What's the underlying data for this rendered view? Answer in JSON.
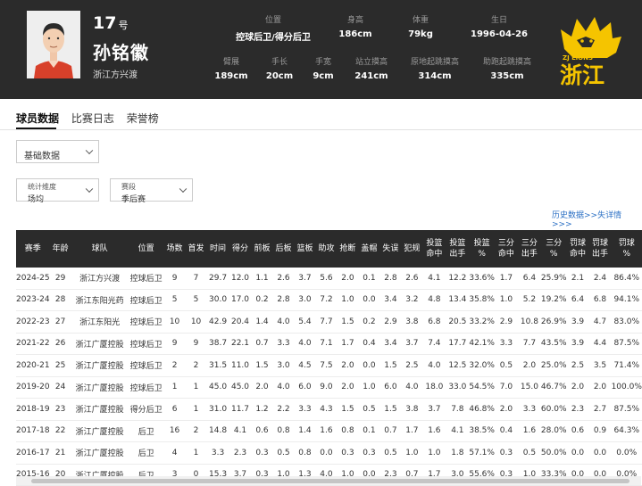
{
  "player": {
    "number": "17",
    "number_suffix": "号",
    "name": "孙铭徽",
    "team": "浙江方兴渡"
  },
  "info_top": [
    {
      "label": "位置",
      "value": "控球后卫/得分后卫"
    },
    {
      "label": "身高",
      "value": "186cm"
    },
    {
      "label": "体重",
      "value": "79kg"
    },
    {
      "label": "生日",
      "value": "1996-04-26"
    }
  ],
  "info_bottom": [
    {
      "label": "臂展",
      "value": "189cm"
    },
    {
      "label": "手长",
      "value": "20cm"
    },
    {
      "label": "手宽",
      "value": "9cm"
    },
    {
      "label": "站立摸高",
      "value": "241cm"
    },
    {
      "label": "原地起跳摸高",
      "value": "314cm"
    },
    {
      "label": "助跑起跳摸高",
      "value": "335cm"
    }
  ],
  "logo": {
    "text_small": "ZJ LIONS",
    "text_big": "浙江",
    "color": "#f5c400"
  },
  "tabs": [
    "球员数据",
    "比赛日志",
    "荣誉榜"
  ],
  "filters": {
    "type": "基础数据",
    "dimension_label": "统计维度",
    "dimension_value": "场均",
    "season_label": "赛段",
    "season_value": "季后赛"
  },
  "history_link": "历史数据>>失详情 >>>",
  "table": {
    "headers": [
      "赛季",
      "年龄",
      "球队",
      "位置",
      "场数",
      "首发",
      "时间",
      "得分",
      "前板",
      "后板",
      "篮板",
      "助攻",
      "抢断",
      "盖帽",
      "失误",
      "犯规",
      "投篮\n命中",
      "投篮\n出手",
      "投篮\n%",
      "三分\n命中",
      "三分\n出手",
      "三分\n%",
      "罚球\n命中",
      "罚球\n%"
    ],
    "rows": [
      [
        "2024-25",
        "29",
        "浙江方兴渡",
        "控球后卫",
        "9",
        "7",
        "29.7",
        "12.0",
        "1.1",
        "2.6",
        "3.7",
        "5.6",
        "2.0",
        "0.1",
        "2.8",
        "2.6",
        "4.1",
        "12.2",
        "33.6%",
        "1.7",
        "6.4",
        "25.9%",
        "2.1",
        "2.4",
        "86.4%"
      ],
      [
        "2023-24",
        "28",
        "浙江东阳光药",
        "控球后卫",
        "5",
        "5",
        "30.0",
        "17.0",
        "0.2",
        "2.8",
        "3.0",
        "7.2",
        "1.0",
        "0.0",
        "3.4",
        "3.2",
        "4.8",
        "13.4",
        "35.8%",
        "1.0",
        "5.2",
        "19.2%",
        "6.4",
        "6.8",
        "94.1%"
      ],
      [
        "2022-23",
        "27",
        "浙江东阳光",
        "控球后卫",
        "10",
        "10",
        "42.9",
        "20.4",
        "1.4",
        "4.0",
        "5.4",
        "7.7",
        "1.5",
        "0.2",
        "2.9",
        "3.8",
        "6.8",
        "20.5",
        "33.2%",
        "2.9",
        "10.8",
        "26.9%",
        "3.9",
        "4.7",
        "83.0%"
      ],
      [
        "2021-22",
        "26",
        "浙江广厦控股",
        "控球后卫",
        "9",
        "9",
        "38.7",
        "22.1",
        "0.7",
        "3.3",
        "4.0",
        "7.1",
        "1.7",
        "0.4",
        "3.4",
        "3.7",
        "7.4",
        "17.7",
        "42.1%",
        "3.3",
        "7.7",
        "43.5%",
        "3.9",
        "4.4",
        "87.5%"
      ],
      [
        "2020-21",
        "25",
        "浙江广厦控股",
        "控球后卫",
        "2",
        "2",
        "31.5",
        "11.0",
        "1.5",
        "3.0",
        "4.5",
        "7.5",
        "2.0",
        "0.0",
        "1.5",
        "2.5",
        "4.0",
        "12.5",
        "32.0%",
        "0.5",
        "2.0",
        "25.0%",
        "2.5",
        "3.5",
        "71.4%"
      ],
      [
        "2019-20",
        "24",
        "浙江广厦控股",
        "控球后卫",
        "1",
        "1",
        "45.0",
        "45.0",
        "2.0",
        "4.0",
        "6.0",
        "9.0",
        "2.0",
        "1.0",
        "6.0",
        "4.0",
        "18.0",
        "33.0",
        "54.5%",
        "7.0",
        "15.0",
        "46.7%",
        "2.0",
        "2.0",
        "100.0%"
      ],
      [
        "2018-19",
        "23",
        "浙江广厦控股",
        "得分后卫",
        "6",
        "1",
        "31.0",
        "11.7",
        "1.2",
        "2.2",
        "3.3",
        "4.3",
        "1.5",
        "0.5",
        "1.5",
        "3.8",
        "3.7",
        "7.8",
        "46.8%",
        "2.0",
        "3.3",
        "60.0%",
        "2.3",
        "2.7",
        "87.5%"
      ],
      [
        "2017-18",
        "22",
        "浙江广厦控股",
        "后卫",
        "16",
        "2",
        "14.8",
        "4.1",
        "0.6",
        "0.8",
        "1.4",
        "1.6",
        "0.8",
        "0.1",
        "0.7",
        "1.7",
        "1.6",
        "4.1",
        "38.5%",
        "0.4",
        "1.6",
        "28.0%",
        "0.6",
        "0.9",
        "64.3%"
      ],
      [
        "2016-17",
        "21",
        "浙江广厦控股",
        "后卫",
        "4",
        "1",
        "3.3",
        "2.3",
        "0.3",
        "0.5",
        "0.8",
        "0.0",
        "0.3",
        "0.3",
        "0.5",
        "1.0",
        "1.0",
        "1.8",
        "57.1%",
        "0.3",
        "0.5",
        "50.0%",
        "0.0",
        "0.0",
        "0.0%"
      ],
      [
        "2015-16",
        "20",
        "浙江广厦控股",
        "后卫",
        "3",
        "0",
        "15.3",
        "3.7",
        "0.3",
        "1.0",
        "1.3",
        "4.0",
        "1.0",
        "0.0",
        "2.3",
        "0.7",
        "1.7",
        "3.0",
        "55.6%",
        "0.3",
        "1.0",
        "33.3%",
        "0.0",
        "0.0",
        "0.0%"
      ]
    ]
  }
}
